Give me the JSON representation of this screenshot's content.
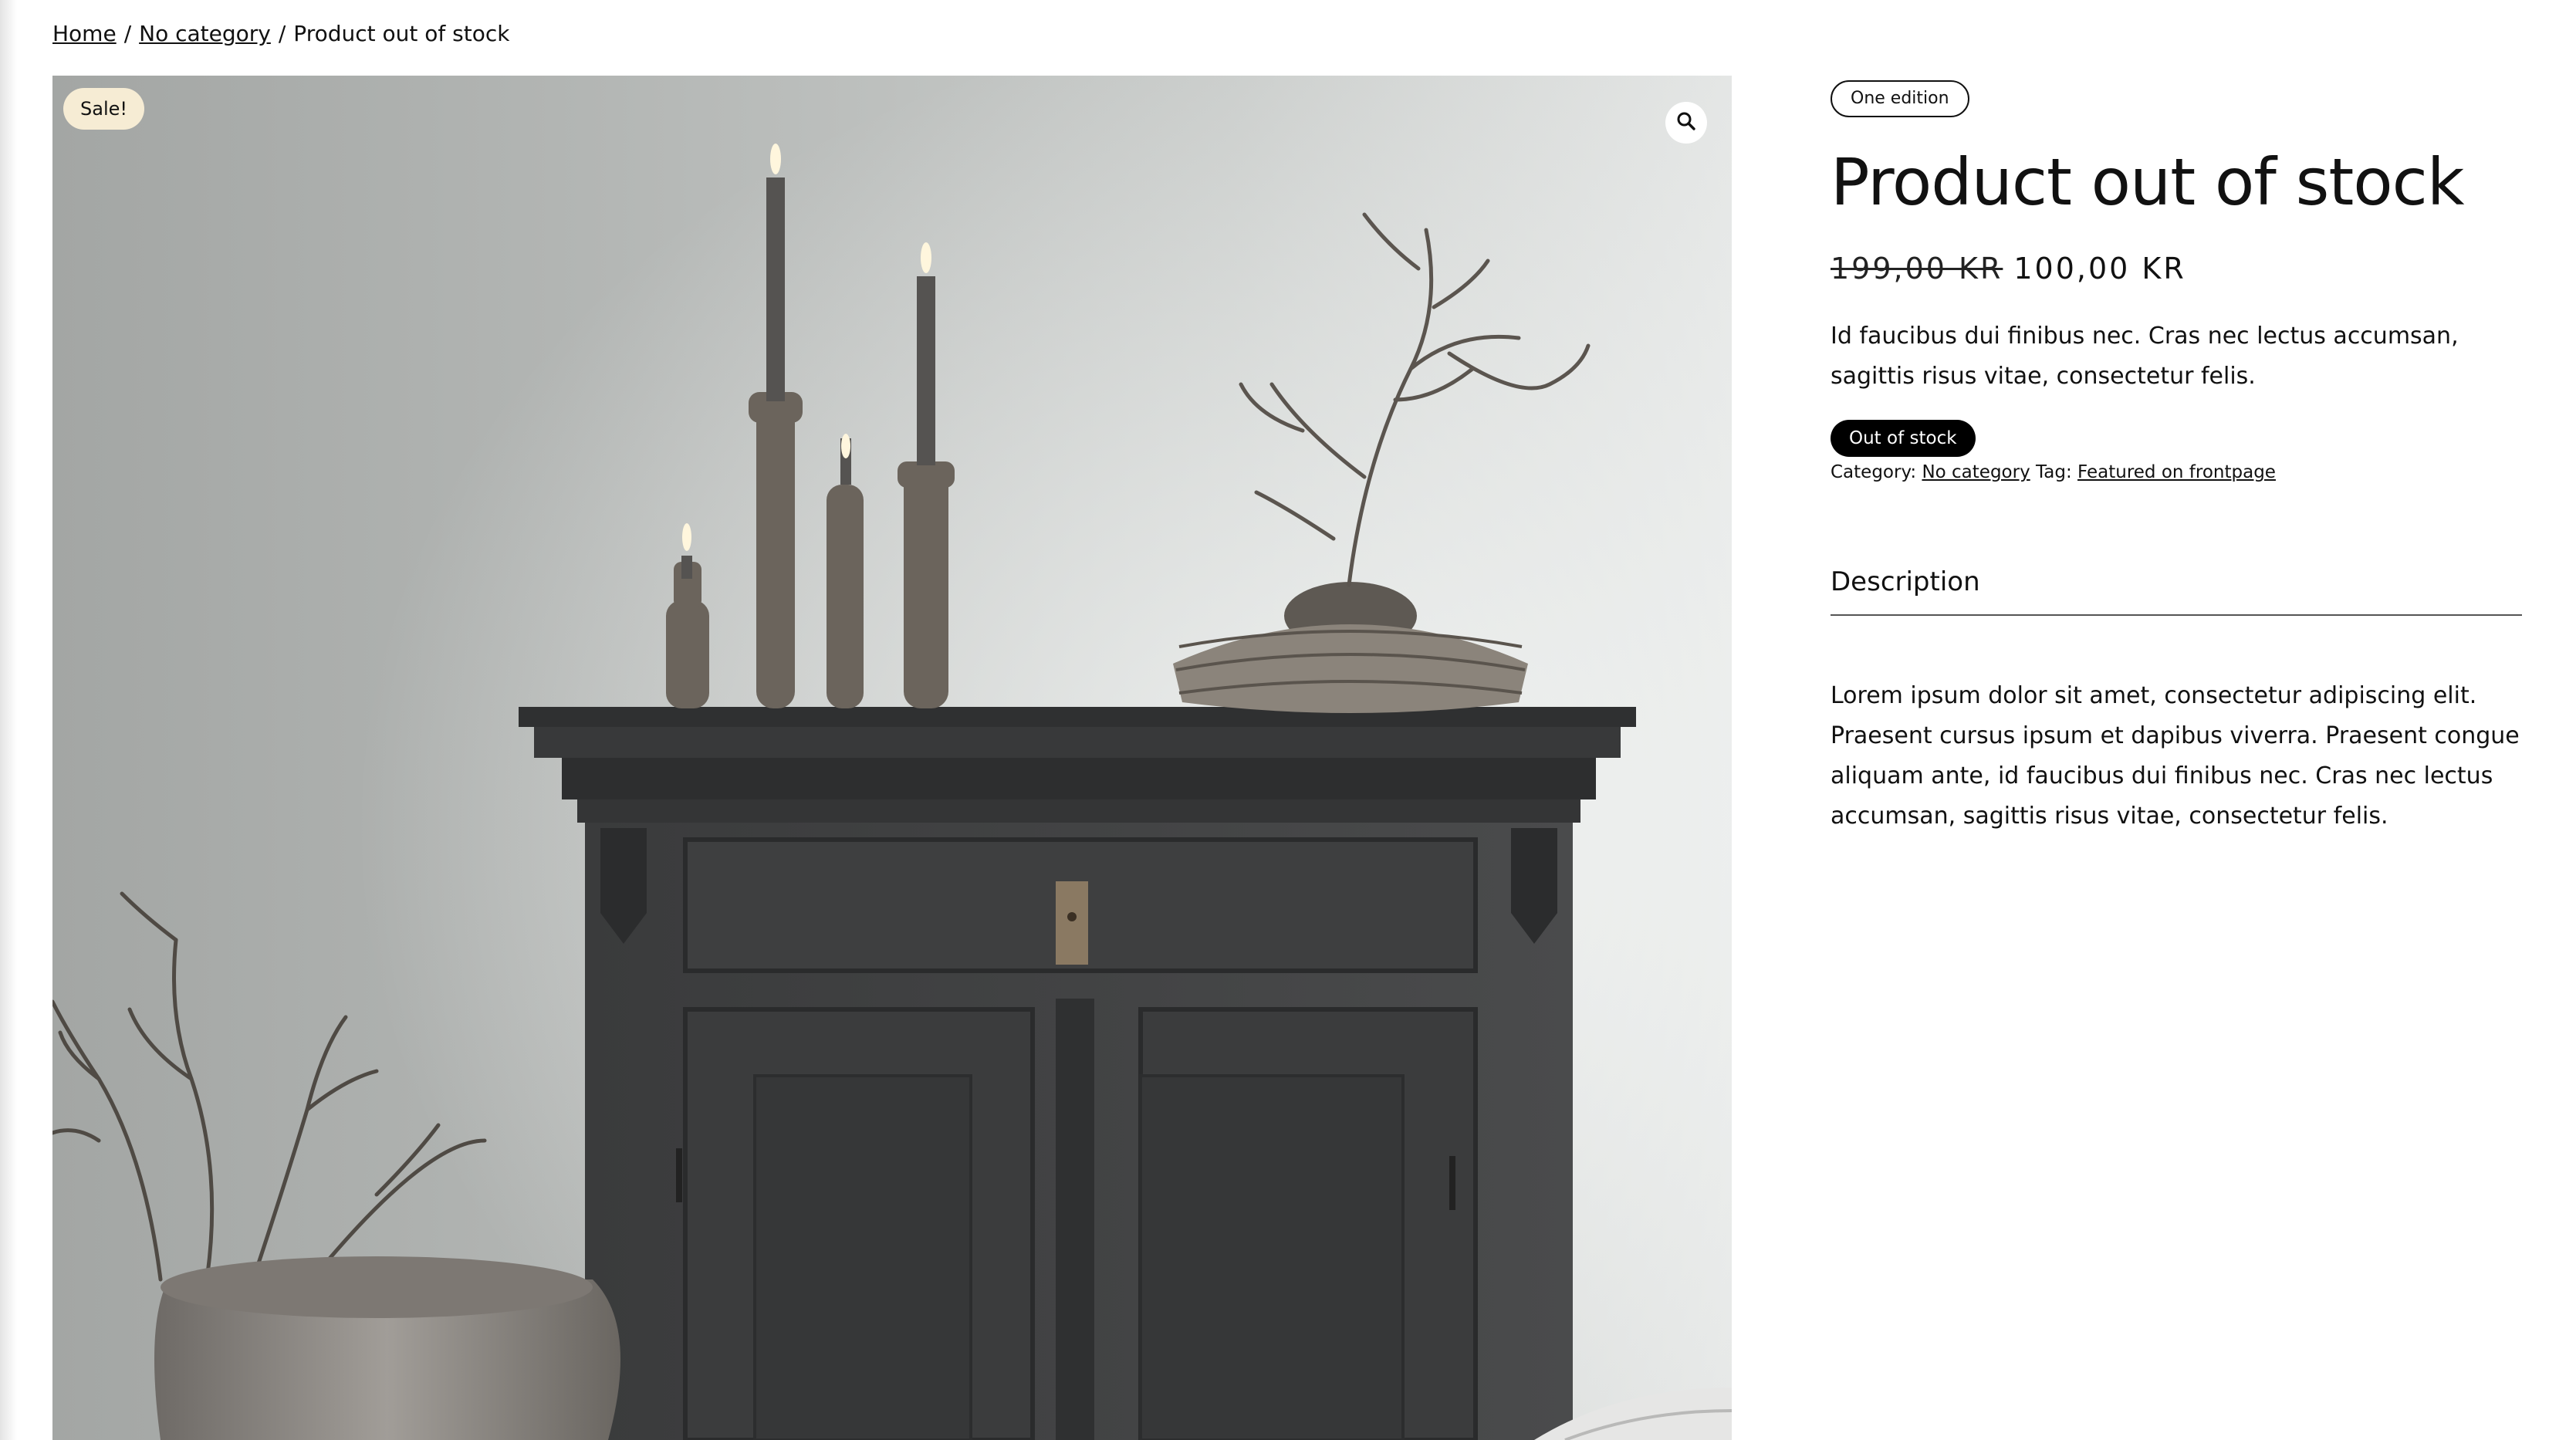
{
  "breadcrumb": {
    "home": "Home",
    "separator": "/",
    "category": "No category",
    "current": "Product out of stock"
  },
  "gallery": {
    "sale_badge": "Sale!",
    "zoom_icon": "search-icon",
    "image_subject": "product-photo"
  },
  "product": {
    "edition_badge": "One edition",
    "title": "Product out of stock",
    "price_old": "199,00 KR",
    "price_new": "100,00 KR",
    "short_description": "Id faucibus dui finibus nec. Cras nec lectus accumsan, sagittis risus vitae, consectetur felis.",
    "stock_status": "Out of stock",
    "meta": {
      "category_label": "Category:",
      "category_value": "No category",
      "tag_label": "Tag:",
      "tag_value": "Featured on frontpage"
    }
  },
  "tabs": {
    "description_label": "Description",
    "description_body": "Lorem ipsum dolor sit amet, consectetur adipiscing elit. Praesent cursus ipsum et dapibus viverra. Praesent congue aliquam ante, id faucibus dui finibus nec. Cras nec lectus accumsan, sagittis risus vitae, consectetur felis."
  },
  "colors": {
    "sale_badge_bg": "#f6ecd4",
    "stock_badge_bg": "#000000",
    "text": "#111111"
  }
}
